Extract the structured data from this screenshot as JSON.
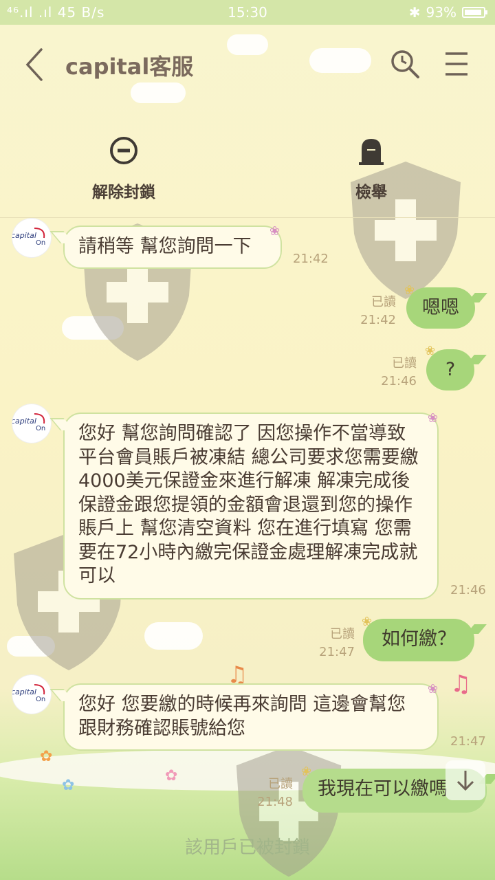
{
  "status_bar": {
    "left": "⁴⁶.ıl .ıl 45 B/s",
    "time": "15:30",
    "bluetooth": "✱",
    "battery": "93%"
  },
  "header": {
    "title": "capital客服",
    "icons": [
      "back-arrow-icon",
      "search-icon",
      "menu-icon"
    ]
  },
  "actions": {
    "unblock": "解除封鎖",
    "report": "檢舉"
  },
  "avatar_label": "capital On",
  "messages": [
    {
      "side": "left",
      "text": "請稍等 幫您詢問一下",
      "time": "21:42"
    },
    {
      "side": "right",
      "text": "嗯嗯",
      "read": "已讀",
      "time": "21:42"
    },
    {
      "side": "right",
      "text": "?",
      "read": "已讀",
      "time": "21:46"
    },
    {
      "side": "left",
      "text": "您好 幫您詢問確認了 因您操作不當導致平台會員賬戶被凍結 總公司要求您需要繳4000美元保證金來進行解凍 解凍完成後保證金跟您提領的金額會退還到您的操作賬戶上 幫您清空資料 您在進行填寫 您需要在72小時內繳完保證金處理解凍完成就可以",
      "time": "21:46"
    },
    {
      "side": "right",
      "text": "如何繳？",
      "read": "已讀",
      "time": "21:47"
    },
    {
      "side": "left",
      "text": "您好 您要繳的時候再來詢問 這邊會幫您跟財務確認賬號給您",
      "time": "21:47"
    },
    {
      "side": "right",
      "text": "我現在可以繳嗎",
      "read": "已讀",
      "time": "21:48"
    }
  ],
  "footer": {
    "blocked_notice": "該用戶已被封鎖"
  },
  "colors": {
    "my_bubble": "#a7d67a",
    "their_bubble": "#fffbe8",
    "title_text": "#7b6a5d"
  }
}
